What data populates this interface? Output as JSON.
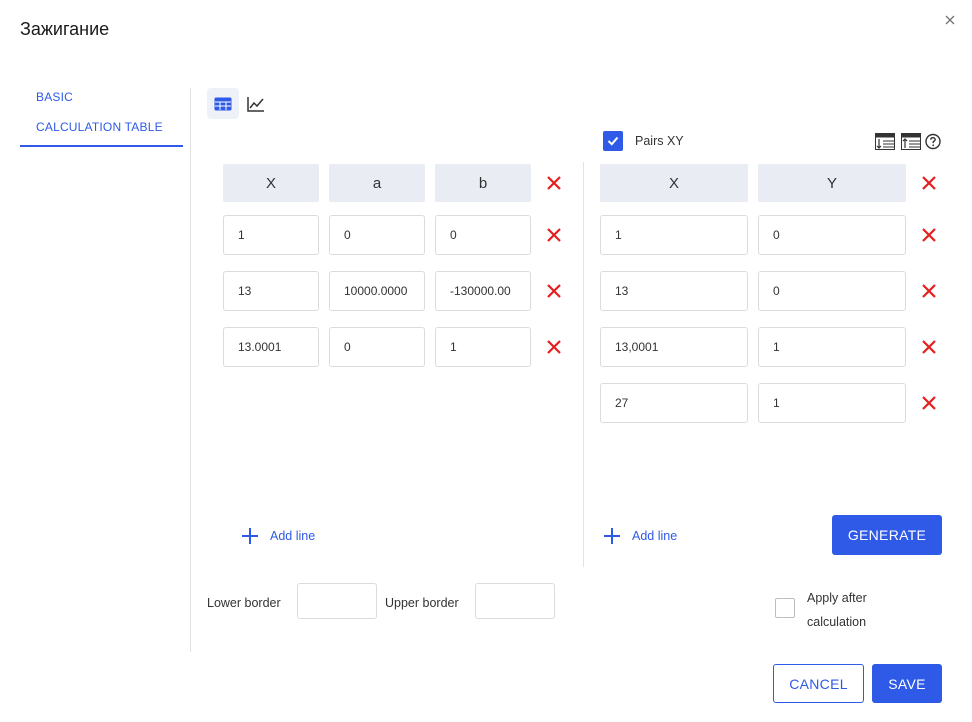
{
  "dialog": {
    "title": "Зажигание"
  },
  "sidebar": {
    "items": [
      {
        "label": "BASIC"
      },
      {
        "label": "CALCULATION TABLE"
      }
    ]
  },
  "toolbar": {
    "pairs_label": "Pairs XY",
    "pairs_checked": true
  },
  "table_left": {
    "headers": [
      "X",
      "a",
      "b"
    ],
    "rows": [
      [
        "1",
        "0",
        "0"
      ],
      [
        "13",
        "10000.0000",
        "-130000.00"
      ],
      [
        "13.0001",
        "0",
        "1"
      ]
    ],
    "add_label": "Add line"
  },
  "table_right": {
    "headers": [
      "X",
      "Y"
    ],
    "rows": [
      [
        "1",
        "0"
      ],
      [
        "13",
        "0"
      ],
      [
        "13,0001",
        "1"
      ],
      [
        "27",
        "1"
      ]
    ],
    "add_label": "Add line",
    "generate_label": "GENERATE"
  },
  "borders": {
    "lower_label": "Lower border",
    "upper_label": "Upper border",
    "lower_value": "",
    "upper_value": ""
  },
  "apply": {
    "label": "Apply after calculation",
    "checked": false
  },
  "footer": {
    "cancel_label": "CANCEL",
    "save_label": "SAVE"
  },
  "colors": {
    "accent": "#2f5ae8",
    "delete": "#e41e1e",
    "header_bg": "#e9ecf3"
  },
  "icons": [
    "close-icon",
    "table-view-icon",
    "chart-view-icon",
    "check-icon",
    "import-table-icon",
    "export-table-icon",
    "help-icon",
    "delete-icon",
    "plus-icon"
  ]
}
